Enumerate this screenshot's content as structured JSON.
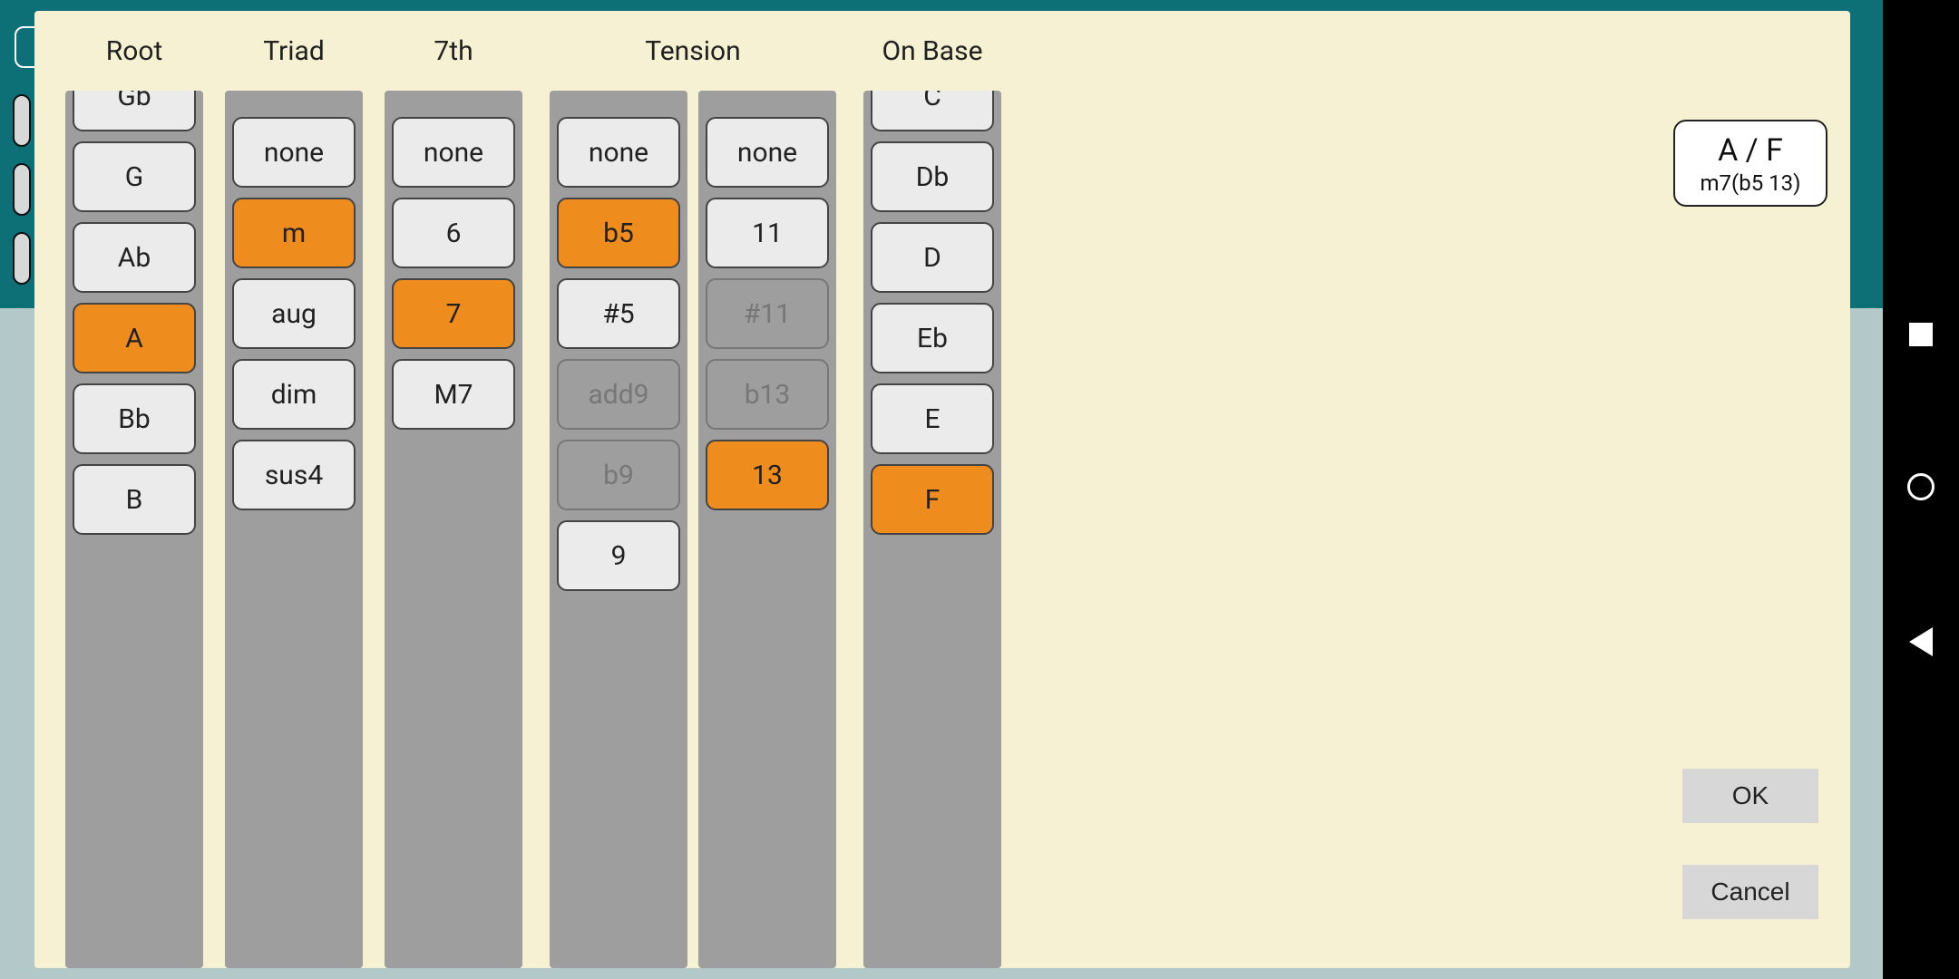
{
  "headers": {
    "root": "Root",
    "triad": "Triad",
    "seventh": "7th",
    "tension": "Tension",
    "onbase": "On Base"
  },
  "root": {
    "items": [
      "Gb",
      "G",
      "Ab",
      "A",
      "Bb",
      "B"
    ],
    "selected": "A"
  },
  "triad": {
    "items": [
      "none",
      "m",
      "aug",
      "dim",
      "sus4"
    ],
    "selected": "m"
  },
  "seventh": {
    "items": [
      "none",
      "6",
      "7",
      "M7"
    ],
    "selected": "7"
  },
  "tension1": {
    "items": [
      "none",
      "b5",
      "#5",
      "add9",
      "b9",
      "9"
    ],
    "selected": "b5",
    "disabled": [
      "add9",
      "b9"
    ]
  },
  "tension2": {
    "items": [
      "none",
      "11",
      "#11",
      "b13",
      "13"
    ],
    "selected": "13",
    "disabled": [
      "#11",
      "b13"
    ]
  },
  "onbase": {
    "items": [
      "C",
      "Db",
      "D",
      "Eb",
      "E",
      "F"
    ],
    "selected": "F"
  },
  "display": {
    "line1": "A / F",
    "line2": "m7(b5 13)"
  },
  "buttons": {
    "ok": "OK",
    "cancel": "Cancel"
  }
}
